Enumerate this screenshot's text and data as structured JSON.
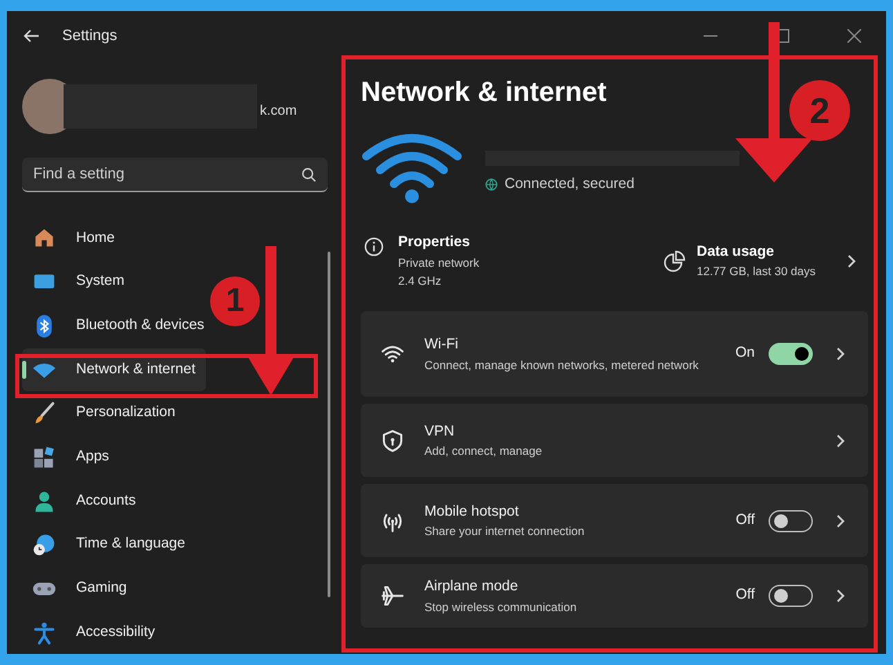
{
  "window": {
    "title": "Settings"
  },
  "account": {
    "email_fragment": "k.com"
  },
  "search": {
    "placeholder": "Find a setting"
  },
  "sidebar": {
    "items": [
      {
        "label": "Home",
        "selected": false
      },
      {
        "label": "System",
        "selected": false
      },
      {
        "label": "Bluetooth & devices",
        "selected": false
      },
      {
        "label": "Network & internet",
        "selected": true
      },
      {
        "label": "Personalization",
        "selected": false
      },
      {
        "label": "Apps",
        "selected": false
      },
      {
        "label": "Accounts",
        "selected": false
      },
      {
        "label": "Time & language",
        "selected": false
      },
      {
        "label": "Gaming",
        "selected": false
      },
      {
        "label": "Accessibility",
        "selected": false
      }
    ]
  },
  "page": {
    "title": "Network & internet",
    "status": "Connected, secured",
    "properties": {
      "title": "Properties",
      "lines": [
        "Private network",
        "2.4 GHz"
      ]
    },
    "data_usage": {
      "title": "Data usage",
      "detail": "12.77 GB, last 30 days"
    }
  },
  "settings": [
    {
      "kind": "toggle",
      "title": "Wi-Fi",
      "description": "Connect, manage known networks, metered network",
      "state_label": "On",
      "on": true
    },
    {
      "kind": "link",
      "title": "VPN",
      "description": "Add, connect, manage"
    },
    {
      "kind": "toggle",
      "title": "Mobile hotspot",
      "description": "Share your internet connection",
      "state_label": "Off",
      "on": false
    },
    {
      "kind": "toggle",
      "title": "Airplane mode",
      "description": "Stop wireless communication",
      "state_label": "Off",
      "on": false
    }
  ],
  "annotations": [
    {
      "number": "1"
    },
    {
      "number": "2"
    }
  ]
}
